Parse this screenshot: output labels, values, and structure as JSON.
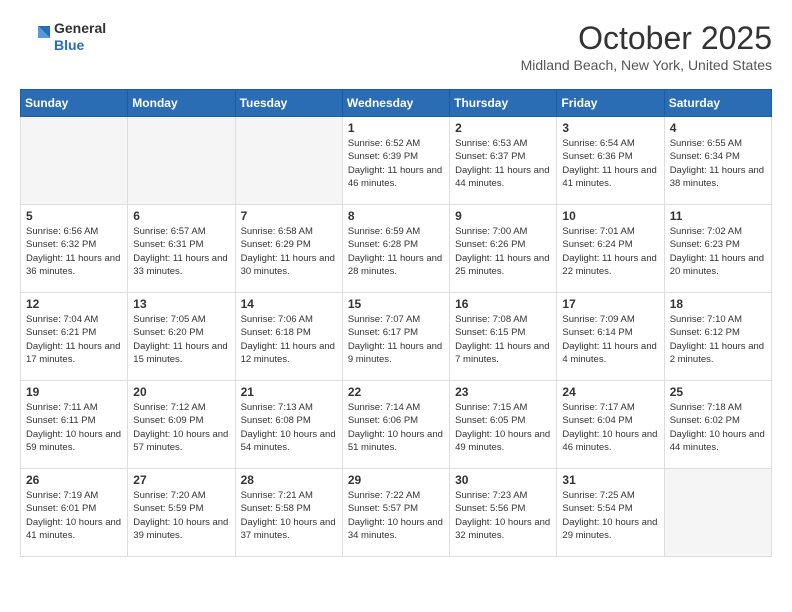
{
  "header": {
    "logo_general": "General",
    "logo_blue": "Blue",
    "month_title": "October 2025",
    "location": "Midland Beach, New York, United States"
  },
  "weekdays": [
    "Sunday",
    "Monday",
    "Tuesday",
    "Wednesday",
    "Thursday",
    "Friday",
    "Saturday"
  ],
  "weeks": [
    [
      {
        "num": "",
        "empty": true
      },
      {
        "num": "",
        "empty": true
      },
      {
        "num": "",
        "empty": true
      },
      {
        "num": "1",
        "sunrise": "6:52 AM",
        "sunset": "6:39 PM",
        "daylight": "11 hours and 46 minutes."
      },
      {
        "num": "2",
        "sunrise": "6:53 AM",
        "sunset": "6:37 PM",
        "daylight": "11 hours and 44 minutes."
      },
      {
        "num": "3",
        "sunrise": "6:54 AM",
        "sunset": "6:36 PM",
        "daylight": "11 hours and 41 minutes."
      },
      {
        "num": "4",
        "sunrise": "6:55 AM",
        "sunset": "6:34 PM",
        "daylight": "11 hours and 38 minutes."
      }
    ],
    [
      {
        "num": "5",
        "sunrise": "6:56 AM",
        "sunset": "6:32 PM",
        "daylight": "11 hours and 36 minutes."
      },
      {
        "num": "6",
        "sunrise": "6:57 AM",
        "sunset": "6:31 PM",
        "daylight": "11 hours and 33 minutes."
      },
      {
        "num": "7",
        "sunrise": "6:58 AM",
        "sunset": "6:29 PM",
        "daylight": "11 hours and 30 minutes."
      },
      {
        "num": "8",
        "sunrise": "6:59 AM",
        "sunset": "6:28 PM",
        "daylight": "11 hours and 28 minutes."
      },
      {
        "num": "9",
        "sunrise": "7:00 AM",
        "sunset": "6:26 PM",
        "daylight": "11 hours and 25 minutes."
      },
      {
        "num": "10",
        "sunrise": "7:01 AM",
        "sunset": "6:24 PM",
        "daylight": "11 hours and 22 minutes."
      },
      {
        "num": "11",
        "sunrise": "7:02 AM",
        "sunset": "6:23 PM",
        "daylight": "11 hours and 20 minutes."
      }
    ],
    [
      {
        "num": "12",
        "sunrise": "7:04 AM",
        "sunset": "6:21 PM",
        "daylight": "11 hours and 17 minutes."
      },
      {
        "num": "13",
        "sunrise": "7:05 AM",
        "sunset": "6:20 PM",
        "daylight": "11 hours and 15 minutes."
      },
      {
        "num": "14",
        "sunrise": "7:06 AM",
        "sunset": "6:18 PM",
        "daylight": "11 hours and 12 minutes."
      },
      {
        "num": "15",
        "sunrise": "7:07 AM",
        "sunset": "6:17 PM",
        "daylight": "11 hours and 9 minutes."
      },
      {
        "num": "16",
        "sunrise": "7:08 AM",
        "sunset": "6:15 PM",
        "daylight": "11 hours and 7 minutes."
      },
      {
        "num": "17",
        "sunrise": "7:09 AM",
        "sunset": "6:14 PM",
        "daylight": "11 hours and 4 minutes."
      },
      {
        "num": "18",
        "sunrise": "7:10 AM",
        "sunset": "6:12 PM",
        "daylight": "11 hours and 2 minutes."
      }
    ],
    [
      {
        "num": "19",
        "sunrise": "7:11 AM",
        "sunset": "6:11 PM",
        "daylight": "10 hours and 59 minutes."
      },
      {
        "num": "20",
        "sunrise": "7:12 AM",
        "sunset": "6:09 PM",
        "daylight": "10 hours and 57 minutes."
      },
      {
        "num": "21",
        "sunrise": "7:13 AM",
        "sunset": "6:08 PM",
        "daylight": "10 hours and 54 minutes."
      },
      {
        "num": "22",
        "sunrise": "7:14 AM",
        "sunset": "6:06 PM",
        "daylight": "10 hours and 51 minutes."
      },
      {
        "num": "23",
        "sunrise": "7:15 AM",
        "sunset": "6:05 PM",
        "daylight": "10 hours and 49 minutes."
      },
      {
        "num": "24",
        "sunrise": "7:17 AM",
        "sunset": "6:04 PM",
        "daylight": "10 hours and 46 minutes."
      },
      {
        "num": "25",
        "sunrise": "7:18 AM",
        "sunset": "6:02 PM",
        "daylight": "10 hours and 44 minutes."
      }
    ],
    [
      {
        "num": "26",
        "sunrise": "7:19 AM",
        "sunset": "6:01 PM",
        "daylight": "10 hours and 41 minutes."
      },
      {
        "num": "27",
        "sunrise": "7:20 AM",
        "sunset": "5:59 PM",
        "daylight": "10 hours and 39 minutes."
      },
      {
        "num": "28",
        "sunrise": "7:21 AM",
        "sunset": "5:58 PM",
        "daylight": "10 hours and 37 minutes."
      },
      {
        "num": "29",
        "sunrise": "7:22 AM",
        "sunset": "5:57 PM",
        "daylight": "10 hours and 34 minutes."
      },
      {
        "num": "30",
        "sunrise": "7:23 AM",
        "sunset": "5:56 PM",
        "daylight": "10 hours and 32 minutes."
      },
      {
        "num": "31",
        "sunrise": "7:25 AM",
        "sunset": "5:54 PM",
        "daylight": "10 hours and 29 minutes."
      },
      {
        "num": "",
        "empty": true
      }
    ]
  ]
}
